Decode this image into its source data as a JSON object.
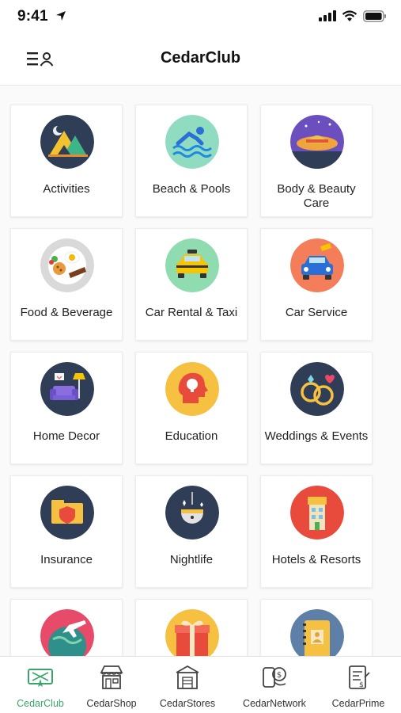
{
  "status": {
    "time": "9:41"
  },
  "header": {
    "title": "CedarClub"
  },
  "categories": [
    {
      "label": "Activities",
      "icon": "camping-icon"
    },
    {
      "label": "Beach & Pools",
      "icon": "swimmer-icon"
    },
    {
      "label": "Body & Beauty Care",
      "icon": "spa-hat-icon"
    },
    {
      "label": "Food & Beverage",
      "icon": "food-plate-icon"
    },
    {
      "label": "Car Rental & Taxi",
      "icon": "taxi-icon"
    },
    {
      "label": "Car Service",
      "icon": "car-service-icon"
    },
    {
      "label": "Home Decor",
      "icon": "armchair-lamp-icon"
    },
    {
      "label": "Education",
      "icon": "head-bulb-icon"
    },
    {
      "label": "Weddings & Events",
      "icon": "rings-icon"
    },
    {
      "label": "Insurance",
      "icon": "shield-folder-icon"
    },
    {
      "label": "Nightlife",
      "icon": "disco-ball-icon"
    },
    {
      "label": "Hotels & Resorts",
      "icon": "hotel-icon"
    },
    {
      "label": "",
      "icon": "globe-plane-icon"
    },
    {
      "label": "",
      "icon": "gift-icon"
    },
    {
      "label": "",
      "icon": "notebook-icon"
    }
  ],
  "bottom_nav": [
    {
      "label": "CedarClub",
      "icon": "ticket-icon",
      "active": true
    },
    {
      "label": "CedarShop",
      "icon": "shop-icon",
      "active": false
    },
    {
      "label": "CedarStores",
      "icon": "store-icon",
      "active": false
    },
    {
      "label": "CedarNetwork",
      "icon": "network-icon",
      "active": false
    },
    {
      "label": "CedarPrime",
      "icon": "prime-icon",
      "active": false
    }
  ],
  "colors": {
    "accent": "#3aa56b",
    "border": "#ececec"
  }
}
